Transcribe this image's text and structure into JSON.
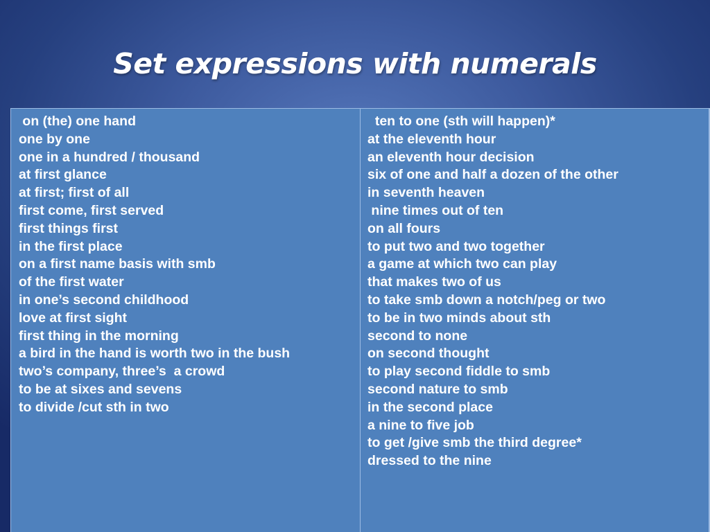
{
  "slide": {
    "title": "Set expressions with numerals",
    "colors": {
      "background_center": "#5577bb",
      "background_edge": "#172a66",
      "cell_fill": "#4f81bd",
      "border": "#9dbbe3",
      "text": "#ffffff"
    }
  },
  "table": {
    "columns": [
      {
        "items": [
          " on (the) one hand",
          "one by one",
          "one in a hundred / thousand",
          "at first glance",
          "at first; first of all",
          "first come, first served",
          "first things first",
          "in the first place",
          "on a first name basis with smb",
          "of the first water",
          "in one’s second childhood",
          "love at first sight",
          "first thing in the morning",
          "a bird in the hand is worth two in the bush",
          "two’s company, three’s  a crowd",
          "to be at sixes and sevens",
          "to divide /cut sth in two"
        ]
      },
      {
        "items": [
          "  ten to one (sth will happen)*",
          "at the eleventh hour",
          "an eleventh hour decision",
          "six of one and half a dozen of the other",
          "in seventh heaven",
          " nine times out of ten",
          "on all fours",
          "to put two and two together",
          "a game at which two can play",
          "that makes two of us",
          "to take smb down a notch/peg or two",
          "to be in two minds about sth",
          "second to none",
          "on second thought",
          "to play second fiddle to smb",
          "second nature to smb",
          "in the second place",
          "a nine to five job",
          "to get /give smb the third degree*",
          "dressed to the nine"
        ]
      }
    ]
  }
}
